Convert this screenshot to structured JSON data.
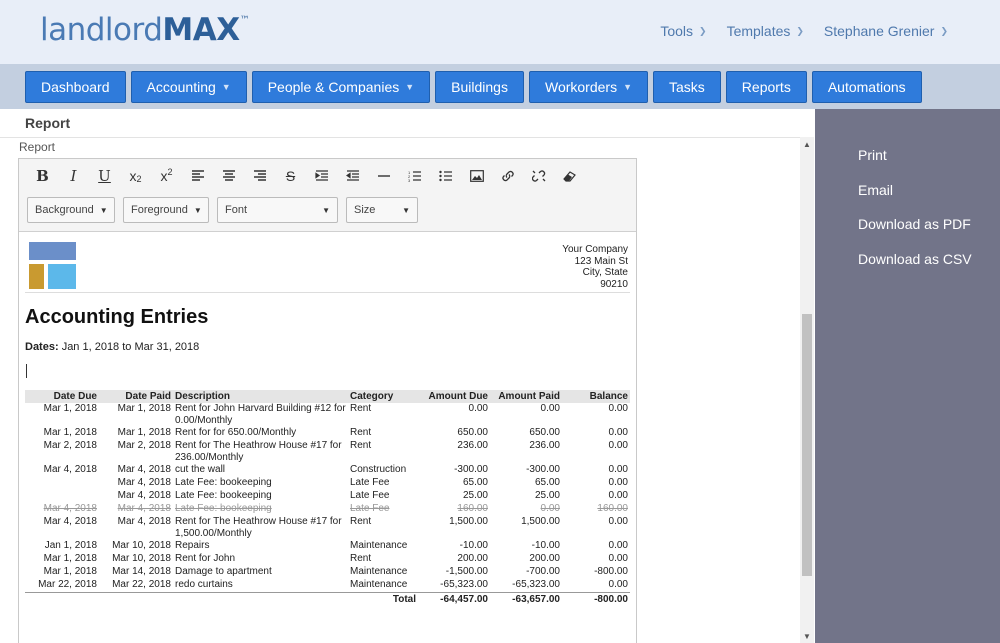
{
  "brand": {
    "part1": "landlord",
    "part2": "MAX",
    "tm": "™"
  },
  "topnav": [
    {
      "label": "Tools"
    },
    {
      "label": "Templates"
    },
    {
      "label": "Stephane Grenier"
    }
  ],
  "navbar": [
    {
      "label": "Dashboard",
      "dropdown": false
    },
    {
      "label": "Accounting",
      "dropdown": true
    },
    {
      "label": "People & Companies",
      "dropdown": true
    },
    {
      "label": "Buildings",
      "dropdown": false
    },
    {
      "label": "Workorders",
      "dropdown": true
    },
    {
      "label": "Tasks",
      "dropdown": false
    },
    {
      "label": "Reports",
      "dropdown": false
    },
    {
      "label": "Automations",
      "dropdown": false
    }
  ],
  "page": {
    "title": "Report",
    "field_label": "Report"
  },
  "toolbar": {
    "dropdowns": [
      "Background",
      "Foreground",
      "Font",
      "Size"
    ]
  },
  "document": {
    "company": [
      "Your Company",
      "123 Main St",
      "City, State",
      "90210"
    ],
    "title": "Accounting Entries",
    "dates_label": "Dates:",
    "dates_value": "Jan 1, 2018 to Mar 31, 2018",
    "columns": [
      "Date Due",
      "Date Paid",
      "Description",
      "Category",
      "Amount Due",
      "Amount Paid",
      "Balance"
    ],
    "rows": [
      {
        "due": "Mar 1, 2018",
        "paid": "Mar 1, 2018",
        "desc": "Rent for John Harvard Building #12 for 0.00/Monthly",
        "cat": "Rent",
        "amt_due": "0.00",
        "amt_paid": "0.00",
        "bal": "0.00",
        "struck": false
      },
      {
        "due": "Mar 1, 2018",
        "paid": "Mar 1, 2018",
        "desc": "Rent for for 650.00/Monthly",
        "cat": "Rent",
        "amt_due": "650.00",
        "amt_paid": "650.00",
        "bal": "0.00",
        "struck": false
      },
      {
        "due": "Mar 2, 2018",
        "paid": "Mar 2, 2018",
        "desc": "Rent for The Heathrow House #17 for 236.00/Monthly",
        "cat": "Rent",
        "amt_due": "236.00",
        "amt_paid": "236.00",
        "bal": "0.00",
        "struck": false
      },
      {
        "due": "Mar 4, 2018",
        "paid": "Mar 4, 2018",
        "desc": "cut the wall",
        "cat": "Construction",
        "amt_due": "-300.00",
        "amt_paid": "-300.00",
        "bal": "0.00",
        "struck": false
      },
      {
        "due": "",
        "paid": "Mar 4, 2018",
        "desc": "Late Fee: bookeeping",
        "cat": "Late Fee",
        "amt_due": "65.00",
        "amt_paid": "65.00",
        "bal": "0.00",
        "struck": false
      },
      {
        "due": "",
        "paid": "Mar 4, 2018",
        "desc": "Late Fee: bookeeping",
        "cat": "Late Fee",
        "amt_due": "25.00",
        "amt_paid": "25.00",
        "bal": "0.00",
        "struck": false
      },
      {
        "due": "Mar 4, 2018",
        "paid": "Mar 4, 2018",
        "desc": "Late Fee: bookeeping",
        "cat": "Late Fee",
        "amt_due": "160.00",
        "amt_paid": "0.00",
        "bal": "160.00",
        "struck": true
      },
      {
        "due": "Mar 4, 2018",
        "paid": "Mar 4, 2018",
        "desc": "Rent for The Heathrow House #17 for 1,500.00/Monthly",
        "cat": "Rent",
        "amt_due": "1,500.00",
        "amt_paid": "1,500.00",
        "bal": "0.00",
        "struck": false
      },
      {
        "due": "Jan 1, 2018",
        "paid": "Mar 10, 2018",
        "desc": "Repairs",
        "cat": "Maintenance",
        "amt_due": "-10.00",
        "amt_paid": "-10.00",
        "bal": "0.00",
        "struck": false
      },
      {
        "due": "Mar 1, 2018",
        "paid": "Mar 10, 2018",
        "desc": "Rent for John",
        "cat": "Rent",
        "amt_due": "200.00",
        "amt_paid": "200.00",
        "bal": "0.00",
        "struck": false
      },
      {
        "due": "Mar 1, 2018",
        "paid": "Mar 14, 2018",
        "desc": "Damage to apartment",
        "cat": "Maintenance",
        "amt_due": "-1,500.00",
        "amt_paid": "-700.00",
        "bal": "-800.00",
        "struck": false
      },
      {
        "due": "Mar 22, 2018",
        "paid": "Mar 22, 2018",
        "desc": "redo curtains",
        "cat": "Maintenance",
        "amt_due": "-65,323.00",
        "amt_paid": "-65,323.00",
        "bal": "0.00",
        "struck": false
      }
    ],
    "total": {
      "label": "Total",
      "amt_due": "-64,457.00",
      "amt_paid": "-63,657.00",
      "bal": "-800.00"
    }
  },
  "side": [
    "Print",
    "Email",
    "Download as PDF",
    "Download as CSV"
  ],
  "colors": {
    "nav_button": "#2f7bdb",
    "side_panel": "#727489",
    "header_bg": "#e8eef8"
  }
}
